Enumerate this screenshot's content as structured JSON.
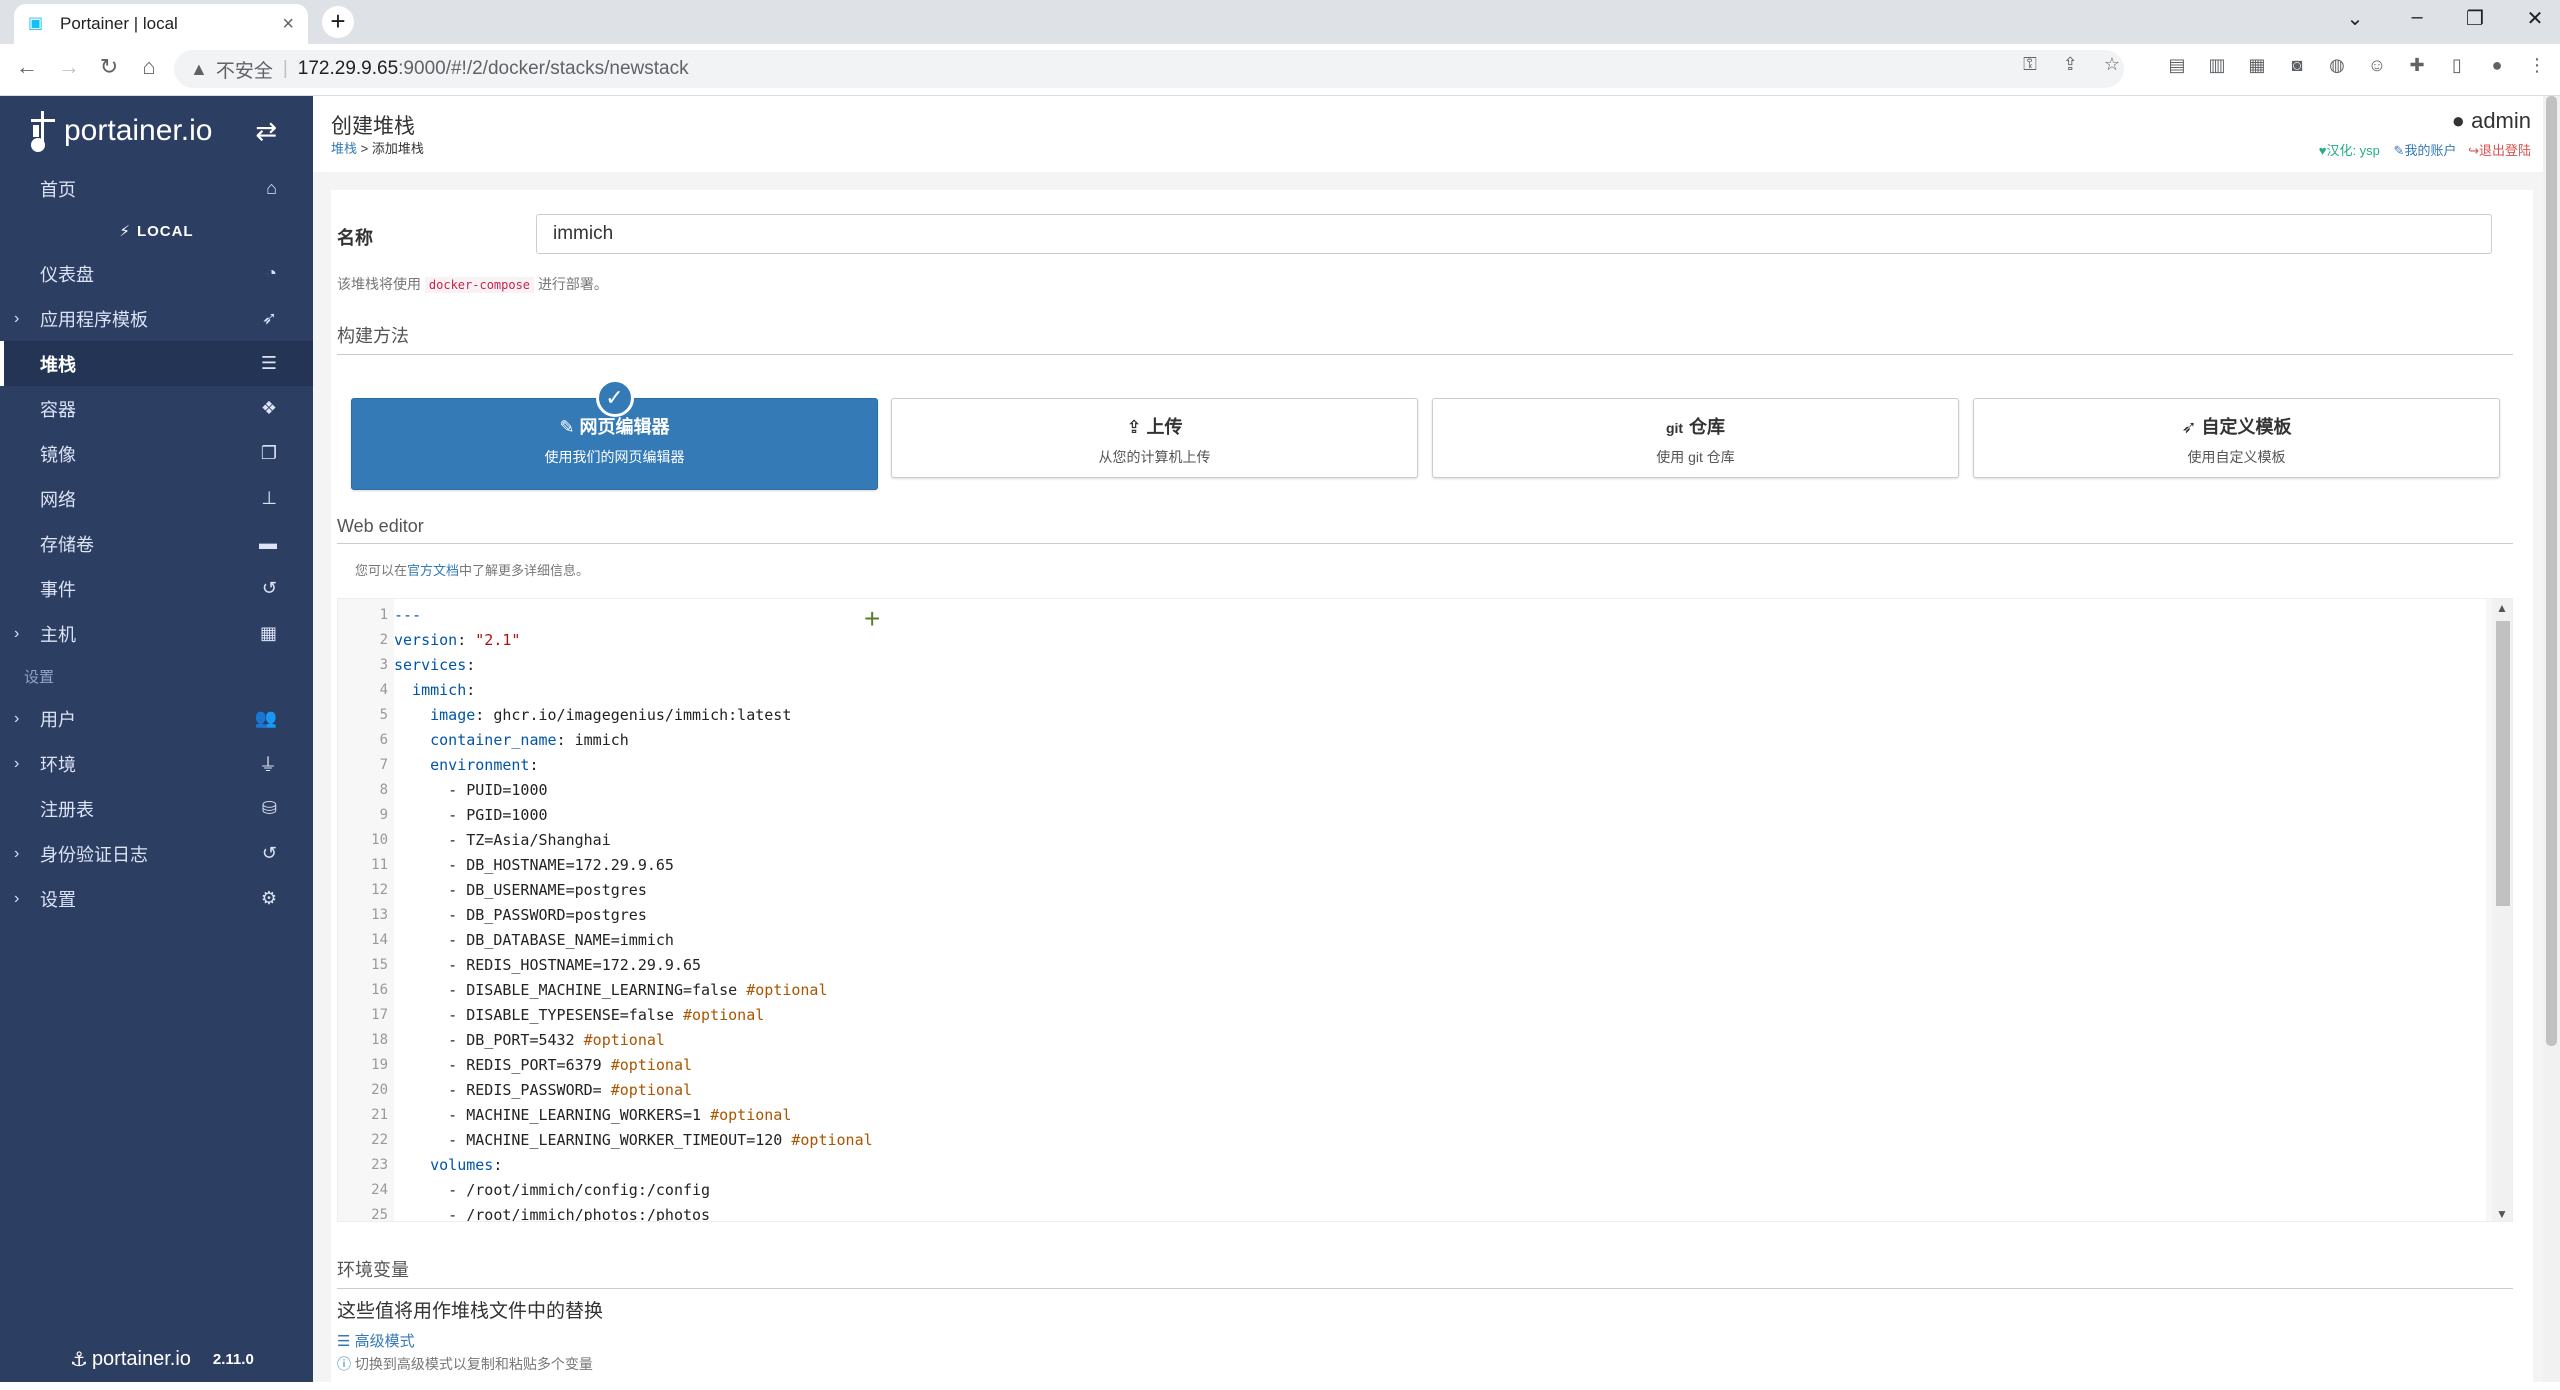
{
  "browser": {
    "tab_title": "Portainer | local",
    "insecure_label": "不安全",
    "url_host": "172.29.9.65",
    "url_path": ":9000/#!/2/docker/stacks/newstack"
  },
  "sidebar": {
    "brand": "portainer.io",
    "home": "首页",
    "env_heading": "LOCAL",
    "items": [
      {
        "label": "仪表盘",
        "icon": "dashboard-icon"
      },
      {
        "label": "应用程序模板",
        "icon": "rocket-icon"
      },
      {
        "label": "堆栈",
        "icon": "stacks-icon"
      },
      {
        "label": "容器",
        "icon": "cubes-icon"
      },
      {
        "label": "镜像",
        "icon": "clone-icon"
      },
      {
        "label": "网络",
        "icon": "sitemap-icon"
      },
      {
        "label": "存储卷",
        "icon": "hdd-icon"
      },
      {
        "label": "事件",
        "icon": "history-icon"
      },
      {
        "label": "主机",
        "icon": "th-icon"
      }
    ],
    "settings_heading": "设置",
    "settings_items": [
      {
        "label": "用户",
        "icon": "users-icon"
      },
      {
        "label": "环境",
        "icon": "plug-icon"
      },
      {
        "label": "注册表",
        "icon": "database-icon"
      },
      {
        "label": "身份验证日志",
        "icon": "history-icon"
      },
      {
        "label": "设置",
        "icon": "cogs-icon"
      }
    ],
    "footer_brand": "portainer.io",
    "version": "2.11.0"
  },
  "header": {
    "title": "创建堆栈",
    "breadcrumb_link": "堆栈",
    "breadcrumb_rest": " > 添加堆栈",
    "user": "admin",
    "localization": "汉化: ysp",
    "my_account": "我的账户",
    "logout": "退出登陆"
  },
  "form": {
    "name_label": "名称",
    "name_value": "immich",
    "compose_hint_pre": "该堆栈将使用",
    "compose_hint_code": "docker-compose",
    "compose_hint_post": "进行部署。",
    "build_method_title": "构建方法",
    "methods": [
      {
        "title": "网页编辑器",
        "desc": "使用我们的网页编辑器",
        "selected": true
      },
      {
        "title": "上传",
        "desc": "从您的计算机上传",
        "selected": false
      },
      {
        "title": "仓库",
        "prefix": "git",
        "desc": "使用 git 仓库",
        "selected": false
      },
      {
        "title": "自定义模板",
        "desc": "使用自定义模板",
        "selected": false
      }
    ],
    "web_editor_title": "Web editor",
    "docs_hint_pre": "您可以在",
    "docs_hint_link": "官方文档",
    "docs_hint_post": "中了解更多详细信息。",
    "env_title": "环境变量",
    "env_desc": "这些值将用作堆栈文件中的替换",
    "advanced_mode": "高级模式",
    "advanced_hint": "切换到高级模式以复制和粘贴多个变量"
  },
  "editor_lines": [
    {
      "n": "1",
      "parts": [
        {
          "t": "---",
          "c": "blue"
        }
      ]
    },
    {
      "n": "2",
      "parts": [
        {
          "t": "version",
          "c": "blue"
        },
        {
          "t": ": ",
          "c": "plain"
        },
        {
          "t": "\"2.1\"",
          "c": "str"
        }
      ]
    },
    {
      "n": "3",
      "parts": [
        {
          "t": "services",
          "c": "blue"
        },
        {
          "t": ":",
          "c": "plain"
        }
      ]
    },
    {
      "n": "4",
      "parts": [
        {
          "t": "  immich",
          "c": "blue"
        },
        {
          "t": ":",
          "c": "plain"
        }
      ]
    },
    {
      "n": "5",
      "parts": [
        {
          "t": "    image",
          "c": "blue"
        },
        {
          "t": ": ghcr.io/imagegenius/immich:latest",
          "c": "plain"
        }
      ]
    },
    {
      "n": "6",
      "parts": [
        {
          "t": "    container_name",
          "c": "blue"
        },
        {
          "t": ": immich",
          "c": "plain"
        }
      ]
    },
    {
      "n": "7",
      "parts": [
        {
          "t": "    environment",
          "c": "blue"
        },
        {
          "t": ":",
          "c": "plain"
        }
      ]
    },
    {
      "n": "8",
      "parts": [
        {
          "t": "      - PUID=1000",
          "c": "plain"
        }
      ]
    },
    {
      "n": "9",
      "parts": [
        {
          "t": "      - PGID=1000",
          "c": "plain"
        }
      ]
    },
    {
      "n": "10",
      "parts": [
        {
          "t": "      - TZ=Asia/Shanghai",
          "c": "plain"
        }
      ]
    },
    {
      "n": "11",
      "parts": [
        {
          "t": "      - DB_HOSTNAME=172.29.9.65",
          "c": "plain"
        }
      ]
    },
    {
      "n": "12",
      "parts": [
        {
          "t": "      - DB_USERNAME=postgres",
          "c": "plain"
        }
      ]
    },
    {
      "n": "13",
      "parts": [
        {
          "t": "      - DB_PASSWORD=postgres",
          "c": "plain"
        }
      ]
    },
    {
      "n": "14",
      "parts": [
        {
          "t": "      - DB_DATABASE_NAME=immich",
          "c": "plain"
        }
      ]
    },
    {
      "n": "15",
      "parts": [
        {
          "t": "      - REDIS_HOSTNAME=172.29.9.65",
          "c": "plain"
        }
      ]
    },
    {
      "n": "16",
      "parts": [
        {
          "t": "      - DISABLE_MACHINE_LEARNING=false ",
          "c": "plain"
        },
        {
          "t": "#optional",
          "c": "com"
        }
      ]
    },
    {
      "n": "17",
      "parts": [
        {
          "t": "      - DISABLE_TYPESENSE=false ",
          "c": "plain"
        },
        {
          "t": "#optional",
          "c": "com"
        }
      ]
    },
    {
      "n": "18",
      "parts": [
        {
          "t": "      - DB_PORT=5432 ",
          "c": "plain"
        },
        {
          "t": "#optional",
          "c": "com"
        }
      ]
    },
    {
      "n": "19",
      "parts": [
        {
          "t": "      - REDIS_PORT=6379 ",
          "c": "plain"
        },
        {
          "t": "#optional",
          "c": "com"
        }
      ]
    },
    {
      "n": "20",
      "parts": [
        {
          "t": "      - REDIS_PASSWORD= ",
          "c": "plain"
        },
        {
          "t": "#optional",
          "c": "com"
        }
      ]
    },
    {
      "n": "21",
      "parts": [
        {
          "t": "      - MACHINE_LEARNING_WORKERS=1 ",
          "c": "plain"
        },
        {
          "t": "#optional",
          "c": "com"
        }
      ]
    },
    {
      "n": "22",
      "parts": [
        {
          "t": "      - MACHINE_LEARNING_WORKER_TIMEOUT=120 ",
          "c": "plain"
        },
        {
          "t": "#optional",
          "c": "com"
        }
      ]
    },
    {
      "n": "23",
      "parts": [
        {
          "t": "    volumes",
          "c": "blue"
        },
        {
          "t": ":",
          "c": "plain"
        }
      ]
    },
    {
      "n": "24",
      "parts": [
        {
          "t": "      - /root/immich/config:/config",
          "c": "plain"
        }
      ]
    },
    {
      "n": "25",
      "parts": [
        {
          "t": "      - /root/immich/photos:/photos",
          "c": "plain"
        }
      ]
    }
  ]
}
